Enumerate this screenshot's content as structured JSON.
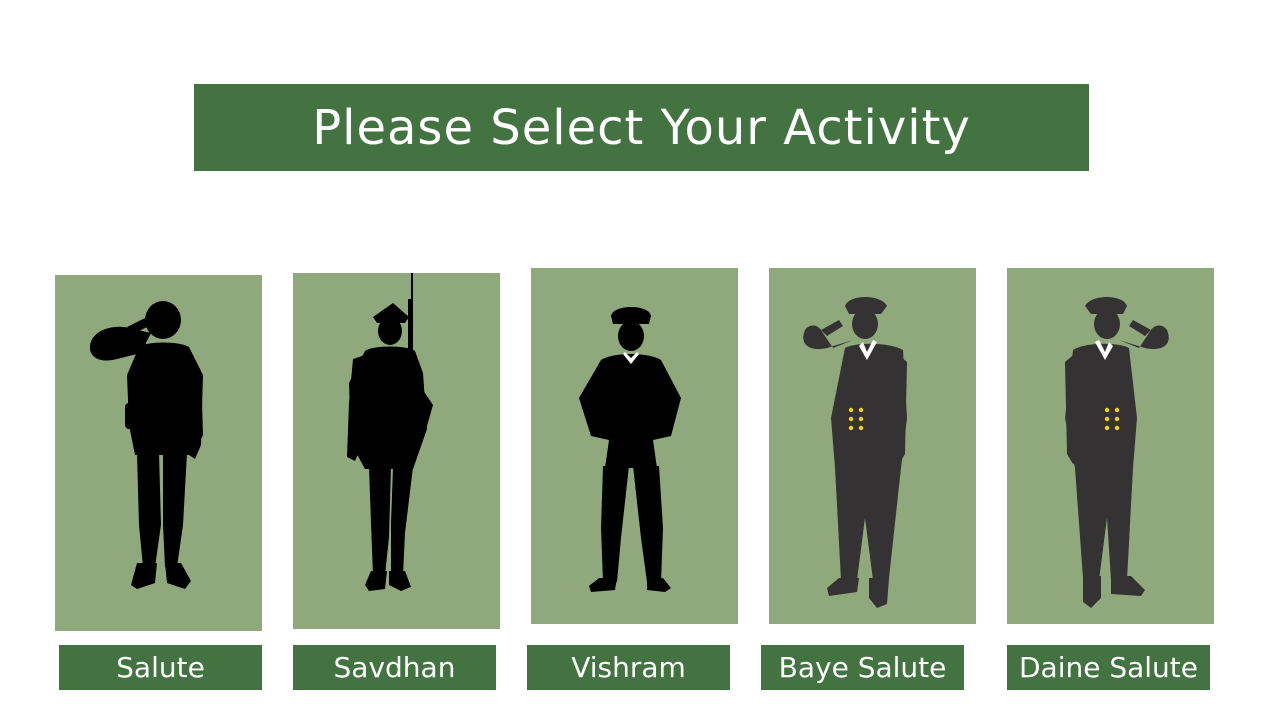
{
  "header": {
    "title": "Please Select Your Activity"
  },
  "colors": {
    "banner": "#437341",
    "card": "#8fa97c",
    "silhouette": "#000000",
    "officer": "#353234",
    "buttons_accent": "#f3d400"
  },
  "activities": [
    {
      "label": "Salute",
      "icon": "saluting-soldier-icon"
    },
    {
      "label": "Savdhan",
      "icon": "soldier-with-rifle-icon"
    },
    {
      "label": "Vishram",
      "icon": "at-ease-soldier-icon"
    },
    {
      "label": "Baye Salute",
      "icon": "left-salute-officer-icon"
    },
    {
      "label": "Daine Salute",
      "icon": "right-salute-officer-icon"
    }
  ]
}
